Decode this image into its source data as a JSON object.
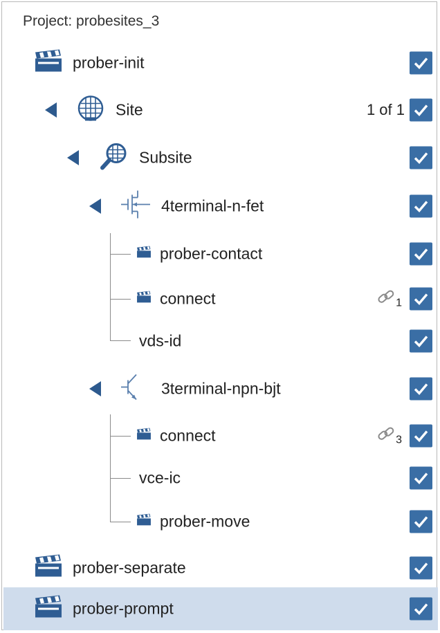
{
  "project": {
    "title": "Project: probesites_3"
  },
  "colors": {
    "accent": "#3a6ea5",
    "selection": "#cfdcec",
    "arrow": "#2d5a8e"
  },
  "tree": {
    "prober_init": {
      "label": "prober-init",
      "icon": "clapperboard-icon",
      "checked": true
    },
    "site": {
      "label": "Site",
      "icon": "wafer-icon",
      "count": "1 of 1",
      "checked": true
    },
    "subsite": {
      "label": "Subsite",
      "icon": "subsite-magnifier-icon",
      "checked": true
    },
    "n_fet": {
      "label": "4terminal-n-fet",
      "icon": "fet-transistor-icon",
      "checked": true
    },
    "prober_contact": {
      "label": "prober-contact",
      "icon": "clapperboard-icon",
      "checked": true
    },
    "connect_1": {
      "label": "connect",
      "icon": "clapperboard-icon",
      "link_count": "1",
      "checked": true
    },
    "vds_id": {
      "label": "vds-id",
      "checked": true
    },
    "npn_bjt": {
      "label": "3terminal-npn-bjt",
      "icon": "bjt-transistor-icon",
      "checked": true
    },
    "connect_2": {
      "label": "connect",
      "icon": "clapperboard-icon",
      "link_count": "3",
      "checked": true
    },
    "vce_ic": {
      "label": "vce-ic",
      "checked": true
    },
    "prober_move": {
      "label": "prober-move",
      "icon": "clapperboard-icon",
      "checked": true
    },
    "prober_separate": {
      "label": "prober-separate",
      "icon": "clapperboard-icon",
      "checked": true
    },
    "prober_prompt": {
      "label": "prober-prompt",
      "icon": "clapperboard-icon",
      "checked": true,
      "selected": true
    }
  }
}
